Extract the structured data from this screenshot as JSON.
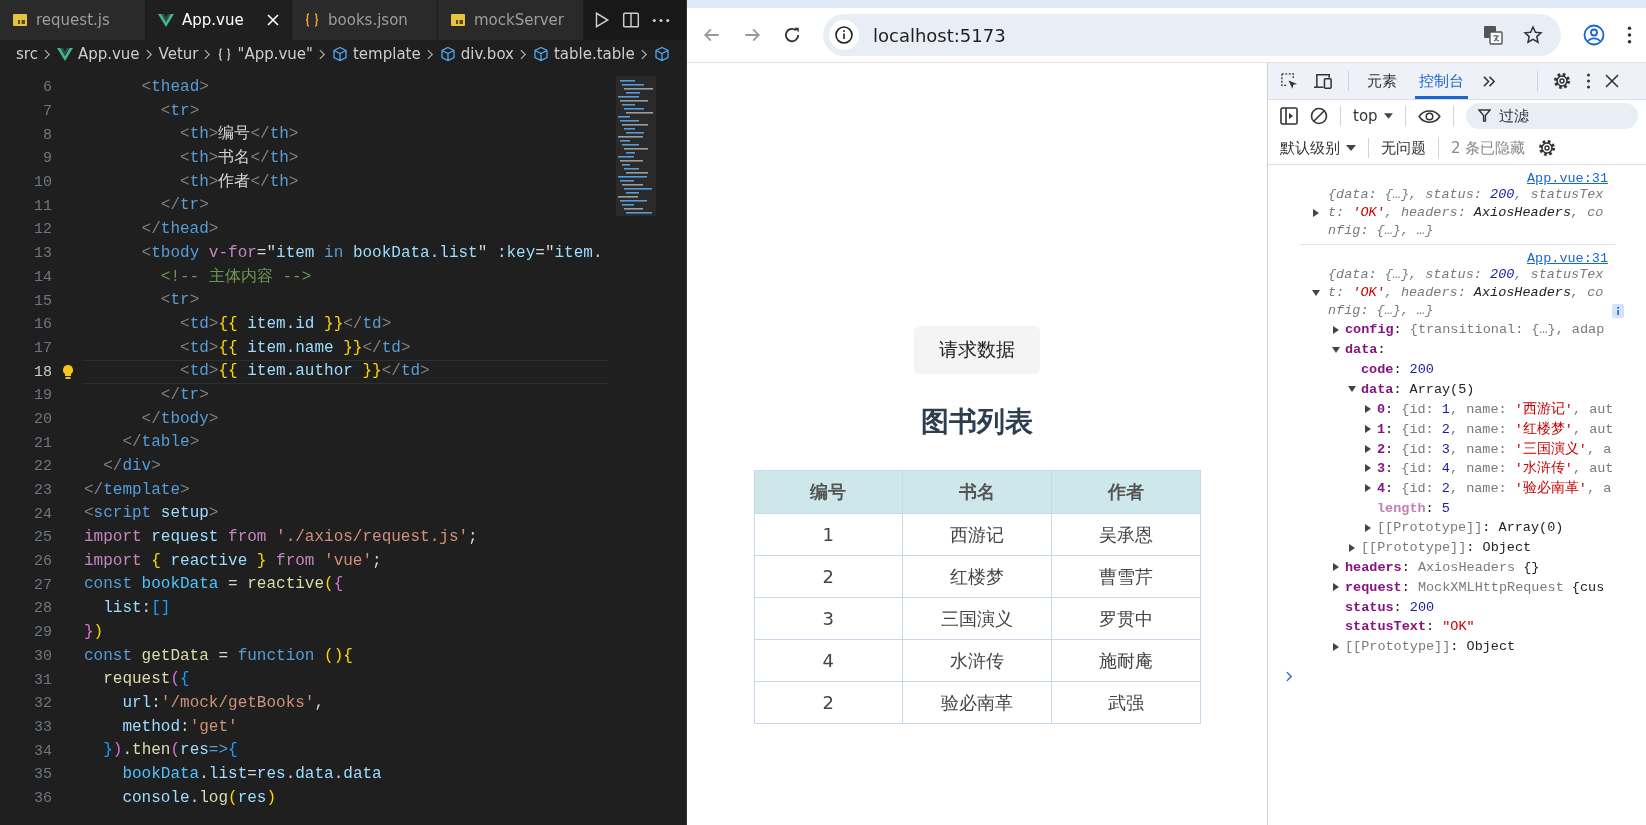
{
  "editor": {
    "tabs": [
      {
        "label": "request.js",
        "kind": "js",
        "selected": false
      },
      {
        "label": "App.vue",
        "kind": "vue",
        "selected": true
      },
      {
        "label": "books.json",
        "kind": "json",
        "selected": false
      },
      {
        "label": "mockServer",
        "kind": "js",
        "selected": false
      }
    ],
    "breadcrumb": [
      {
        "label": "src",
        "kind": "plain"
      },
      {
        "label": "App.vue",
        "kind": "vue"
      },
      {
        "label": "Vetur",
        "kind": "plain"
      },
      {
        "label": "\"App.vue\"",
        "kind": "braces"
      },
      {
        "label": "template",
        "kind": "cube"
      },
      {
        "label": "div.box",
        "kind": "cube"
      },
      {
        "label": "table.table",
        "kind": "cube"
      },
      {
        "kind": "cube"
      }
    ],
    "lines": [
      {
        "number": "6",
        "active": false,
        "tokens": [
          {
            "kind": "p",
            "t": "      <"
          },
          {
            "kind": "t",
            "t": "thead"
          },
          {
            "kind": "p",
            "t": ">"
          }
        ]
      },
      {
        "number": "7",
        "active": false,
        "tokens": [
          {
            "kind": "p",
            "t": "        <"
          },
          {
            "kind": "t",
            "t": "tr"
          },
          {
            "kind": "p",
            "t": ">"
          }
        ]
      },
      {
        "number": "8",
        "active": false,
        "tokens": [
          {
            "kind": "p",
            "t": "          <"
          },
          {
            "kind": "t",
            "t": "th"
          },
          {
            "kind": "p",
            "t": ">"
          },
          {
            "kind": "x",
            "t": "编号"
          },
          {
            "kind": "p",
            "t": "</"
          },
          {
            "kind": "t",
            "t": "th"
          },
          {
            "kind": "p",
            "t": ">"
          }
        ]
      },
      {
        "number": "9",
        "active": false,
        "tokens": [
          {
            "kind": "p",
            "t": "          <"
          },
          {
            "kind": "t",
            "t": "th"
          },
          {
            "kind": "p",
            "t": ">"
          },
          {
            "kind": "x",
            "t": "书名"
          },
          {
            "kind": "p",
            "t": "</"
          },
          {
            "kind": "t",
            "t": "th"
          },
          {
            "kind": "p",
            "t": ">"
          }
        ]
      },
      {
        "number": "10",
        "active": false,
        "tokens": [
          {
            "kind": "p",
            "t": "          <"
          },
          {
            "kind": "t",
            "t": "th"
          },
          {
            "kind": "p",
            "t": ">"
          },
          {
            "kind": "x",
            "t": "作者"
          },
          {
            "kind": "p",
            "t": "</"
          },
          {
            "kind": "t",
            "t": "th"
          },
          {
            "kind": "p",
            "t": ">"
          }
        ]
      },
      {
        "number": "11",
        "active": false,
        "tokens": [
          {
            "kind": "p",
            "t": "        </"
          },
          {
            "kind": "t",
            "t": "tr"
          },
          {
            "kind": "p",
            "t": ">"
          }
        ]
      },
      {
        "number": "12",
        "active": false,
        "tokens": [
          {
            "kind": "p",
            "t": "      </"
          },
          {
            "kind": "t",
            "t": "thead"
          },
          {
            "kind": "p",
            "t": ">"
          }
        ]
      },
      {
        "number": "13",
        "active": false,
        "tokens": [
          {
            "kind": "p",
            "t": "      <"
          },
          {
            "kind": "t",
            "t": "tbody "
          },
          {
            "kind": "a",
            "t": "v-for"
          },
          {
            "kind": "x",
            "t": "=\""
          },
          {
            "kind": "v",
            "t": "item "
          },
          {
            "kind": "st",
            "t": "in "
          },
          {
            "kind": "v",
            "t": "bookData.list"
          },
          {
            "kind": "x",
            "t": "\" "
          },
          {
            "kind": "v",
            "t": ":key"
          },
          {
            "kind": "x",
            "t": "=\""
          },
          {
            "kind": "v",
            "t": "item."
          }
        ]
      },
      {
        "number": "14",
        "active": false,
        "tokens": [
          {
            "kind": "cm",
            "t": "        <!-- 主体内容 -->"
          }
        ]
      },
      {
        "number": "15",
        "active": false,
        "tokens": [
          {
            "kind": "p",
            "t": "        <"
          },
          {
            "kind": "t",
            "t": "tr"
          },
          {
            "kind": "p",
            "t": ">"
          }
        ]
      },
      {
        "number": "16",
        "active": false,
        "tokens": [
          {
            "kind": "p",
            "t": "          <"
          },
          {
            "kind": "t",
            "t": "td"
          },
          {
            "kind": "p",
            "t": ">"
          },
          {
            "kind": "b1",
            "t": "{{"
          },
          {
            "kind": "v",
            "t": " item.id "
          },
          {
            "kind": "b1",
            "t": "}}"
          },
          {
            "kind": "p",
            "t": "</"
          },
          {
            "kind": "t",
            "t": "td"
          },
          {
            "kind": "p",
            "t": ">"
          }
        ]
      },
      {
        "number": "17",
        "active": false,
        "tokens": [
          {
            "kind": "p",
            "t": "          <"
          },
          {
            "kind": "t",
            "t": "td"
          },
          {
            "kind": "p",
            "t": ">"
          },
          {
            "kind": "b1",
            "t": "{{"
          },
          {
            "kind": "v",
            "t": " item.name "
          },
          {
            "kind": "b1",
            "t": "}}"
          },
          {
            "kind": "p",
            "t": "</"
          },
          {
            "kind": "t",
            "t": "td"
          },
          {
            "kind": "p",
            "t": ">"
          }
        ]
      },
      {
        "number": "18",
        "active": true,
        "tokens": [
          {
            "kind": "p",
            "t": "          <"
          },
          {
            "kind": "t",
            "t": "td"
          },
          {
            "kind": "p",
            "t": ">"
          },
          {
            "kind": "b1",
            "t": "{{"
          },
          {
            "kind": "v",
            "t": " item.author "
          },
          {
            "kind": "b1",
            "t": "}}"
          },
          {
            "kind": "p",
            "t": "</"
          },
          {
            "kind": "t",
            "t": "td"
          },
          {
            "kind": "p",
            "t": ">"
          }
        ]
      },
      {
        "number": "19",
        "active": false,
        "tokens": [
          {
            "kind": "p",
            "t": "        </"
          },
          {
            "kind": "t",
            "t": "tr"
          },
          {
            "kind": "p",
            "t": ">"
          }
        ]
      },
      {
        "number": "20",
        "active": false,
        "tokens": [
          {
            "kind": "p",
            "t": "      </"
          },
          {
            "kind": "t",
            "t": "tbody"
          },
          {
            "kind": "p",
            "t": ">"
          }
        ]
      },
      {
        "number": "21",
        "active": false,
        "tokens": [
          {
            "kind": "p",
            "t": "    </"
          },
          {
            "kind": "t",
            "t": "table"
          },
          {
            "kind": "p",
            "t": ">"
          }
        ]
      },
      {
        "number": "22",
        "active": false,
        "tokens": [
          {
            "kind": "p",
            "t": "  </"
          },
          {
            "kind": "t",
            "t": "div"
          },
          {
            "kind": "p",
            "t": ">"
          }
        ]
      },
      {
        "number": "23",
        "active": false,
        "tokens": [
          {
            "kind": "p",
            "t": "</"
          },
          {
            "kind": "t",
            "t": "template"
          },
          {
            "kind": "p",
            "t": ">"
          }
        ]
      },
      {
        "number": "24",
        "active": false,
        "tokens": [
          {
            "kind": "p",
            "t": "<"
          },
          {
            "kind": "t",
            "t": "script"
          },
          {
            "kind": "v",
            "t": " setup"
          },
          {
            "kind": "p",
            "t": ">"
          }
        ]
      },
      {
        "number": "25",
        "active": false,
        "tokens": [
          {
            "kind": "kw",
            "t": "import"
          },
          {
            "kind": "v",
            "t": " request "
          },
          {
            "kind": "kw",
            "t": "from "
          },
          {
            "kind": "s",
            "t": "'./axios/request.js'"
          },
          {
            "kind": "x",
            "t": ";"
          }
        ]
      },
      {
        "number": "26",
        "active": false,
        "tokens": [
          {
            "kind": "kw",
            "t": "import "
          },
          {
            "kind": "b1",
            "t": "{"
          },
          {
            "kind": "v",
            "t": " reactive "
          },
          {
            "kind": "b1",
            "t": "}"
          },
          {
            "kind": "kw",
            "t": " from "
          },
          {
            "kind": "s",
            "t": "'vue'"
          },
          {
            "kind": "x",
            "t": ";"
          }
        ]
      },
      {
        "number": "27",
        "active": false,
        "tokens": [
          {
            "kind": "st",
            "t": "const "
          },
          {
            "kind": "c",
            "t": "bookData"
          },
          {
            "kind": "x",
            "t": " = "
          },
          {
            "kind": "f",
            "t": "reactive"
          },
          {
            "kind": "b1",
            "t": "("
          },
          {
            "kind": "b2",
            "t": "{"
          }
        ]
      },
      {
        "number": "28",
        "active": false,
        "tokens": [
          {
            "kind": "v",
            "t": "  list"
          },
          {
            "kind": "x",
            "t": ":"
          },
          {
            "kind": "b3",
            "t": "[]"
          }
        ]
      },
      {
        "number": "29",
        "active": false,
        "tokens": [
          {
            "kind": "b2",
            "t": "}"
          },
          {
            "kind": "b1",
            "t": ")"
          }
        ]
      },
      {
        "number": "30",
        "active": false,
        "tokens": [
          {
            "kind": "st",
            "t": "const "
          },
          {
            "kind": "f",
            "t": "getData"
          },
          {
            "kind": "x",
            "t": " = "
          },
          {
            "kind": "st",
            "t": "function "
          },
          {
            "kind": "b1",
            "t": "(){"
          }
        ]
      },
      {
        "number": "31",
        "active": false,
        "tokens": [
          {
            "kind": "f",
            "t": "  request"
          },
          {
            "kind": "b2",
            "t": "("
          },
          {
            "kind": "b3",
            "t": "{"
          }
        ]
      },
      {
        "number": "32",
        "active": false,
        "tokens": [
          {
            "kind": "v",
            "t": "    url"
          },
          {
            "kind": "x",
            "t": ":"
          },
          {
            "kind": "s",
            "t": "'/mock/getBooks'"
          },
          {
            "kind": "x",
            "t": ","
          }
        ]
      },
      {
        "number": "33",
        "active": false,
        "tokens": [
          {
            "kind": "v",
            "t": "    method"
          },
          {
            "kind": "x",
            "t": ":"
          },
          {
            "kind": "s",
            "t": "'get'"
          }
        ]
      },
      {
        "number": "34",
        "active": false,
        "tokens": [
          {
            "kind": "b3",
            "t": "  }"
          },
          {
            "kind": "b2",
            "t": ")"
          },
          {
            "kind": "x",
            "t": "."
          },
          {
            "kind": "f",
            "t": "then"
          },
          {
            "kind": "b2",
            "t": "("
          },
          {
            "kind": "v",
            "t": "res"
          },
          {
            "kind": "st",
            "t": "=>"
          },
          {
            "kind": "b3",
            "t": "{"
          }
        ]
      },
      {
        "number": "35",
        "active": false,
        "tokens": [
          {
            "kind": "c",
            "t": "    bookData"
          },
          {
            "kind": "x",
            "t": "."
          },
          {
            "kind": "v",
            "t": "list"
          },
          {
            "kind": "x",
            "t": "="
          },
          {
            "kind": "v",
            "t": "res"
          },
          {
            "kind": "x",
            "t": "."
          },
          {
            "kind": "v",
            "t": "data"
          },
          {
            "kind": "x",
            "t": "."
          },
          {
            "kind": "v",
            "t": "data"
          }
        ]
      },
      {
        "number": "36",
        "active": false,
        "tokens": [
          {
            "kind": "v",
            "t": "    console"
          },
          {
            "kind": "x",
            "t": "."
          },
          {
            "kind": "f",
            "t": "log"
          },
          {
            "kind": "b1",
            "t": "("
          },
          {
            "kind": "v",
            "t": "res"
          },
          {
            "kind": "b1",
            "t": ")"
          }
        ]
      }
    ]
  },
  "browser": {
    "url": "localhost:5173"
  },
  "page": {
    "button": "请求数据",
    "heading": "图书列表",
    "table": {
      "columns": [
        "编号",
        "书名",
        "作者"
      ],
      "rows": [
        [
          "1",
          "西游记",
          "吴承恩"
        ],
        [
          "2",
          "红楼梦",
          "曹雪芹"
        ],
        [
          "3",
          "三国演义",
          "罗贯中"
        ],
        [
          "4",
          "水浒传",
          "施耐庵"
        ],
        [
          "2",
          "验必南革",
          "武强"
        ]
      ]
    }
  },
  "devtools": {
    "tabs": [
      {
        "label": "元素",
        "selected": false
      },
      {
        "label": "控制台",
        "selected": true
      }
    ],
    "context": "top",
    "filter_placeholder": "过滤",
    "level": "默认级别",
    "issues": "无问题",
    "hidden": "2 条已隐藏",
    "console": [
      {
        "source": "App.vue:31",
        "expanded": false,
        "summary": [
          {
            "kind": "g",
            "t": "{data: {…}, status: "
          },
          {
            "kind": "n",
            "t": "200"
          },
          {
            "kind": "g",
            "t": ", statusText: "
          },
          {
            "kind": "r",
            "t": "'OK'"
          },
          {
            "kind": "g",
            "t": ", headers: "
          },
          {
            "kind": "o",
            "t": "AxiosHeaders"
          },
          {
            "kind": "g",
            "t": ", config: {…},  …}"
          }
        ]
      },
      {
        "source": "App.vue:31",
        "expanded": true,
        "summary": [
          {
            "kind": "g",
            "t": "{data: {…}, status: "
          },
          {
            "kind": "n",
            "t": "200"
          },
          {
            "kind": "g",
            "t": ", statusText: "
          },
          {
            "kind": "r",
            "t": "'OK'"
          },
          {
            "kind": "g",
            "t": ", headers: "
          },
          {
            "kind": "o",
            "t": "AxiosHeaders"
          },
          {
            "kind": "g",
            "t": ", config: {…},  …}"
          }
        ],
        "children": [
          {
            "kind": "branch",
            "expanded": false,
            "text": [
              {
                "kind": "key",
                "t": "config"
              },
              {
                "kind": "o",
                "t": ": "
              },
              {
                "kind": "g",
                "t": "{transitional: {…}, adap"
              }
            ]
          },
          {
            "kind": "branch",
            "expanded": true,
            "text": [
              {
                "kind": "key",
                "t": "data"
              },
              {
                "kind": "o",
                "t": ":"
              }
            ],
            "children": [
              {
                "kind": "leaf",
                "text": [
                  {
                    "kind": "key",
                    "t": "code"
                  },
                  {
                    "kind": "o",
                    "t": ": "
                  },
                  {
                    "kind": "n",
                    "t": "200"
                  }
                ]
              },
              {
                "kind": "branch",
                "expanded": true,
                "text": [
                  {
                    "kind": "key",
                    "t": "data"
                  },
                  {
                    "kind": "o",
                    "t": ": Array(5)"
                  }
                ],
                "children": [
                  {
                    "kind": "branch",
                    "expanded": false,
                    "text": [
                      {
                        "kind": "key",
                        "t": "0"
                      },
                      {
                        "kind": "o",
                        "t": ": "
                      },
                      {
                        "kind": "g",
                        "t": "{id: "
                      },
                      {
                        "kind": "n",
                        "t": "1"
                      },
                      {
                        "kind": "g",
                        "t": ", name: "
                      },
                      {
                        "kind": "r",
                        "t": "'西游记'"
                      },
                      {
                        "kind": "g",
                        "t": ", aut"
                      }
                    ]
                  },
                  {
                    "kind": "branch",
                    "expanded": false,
                    "text": [
                      {
                        "kind": "key",
                        "t": "1"
                      },
                      {
                        "kind": "o",
                        "t": ": "
                      },
                      {
                        "kind": "g",
                        "t": "{id: "
                      },
                      {
                        "kind": "n",
                        "t": "2"
                      },
                      {
                        "kind": "g",
                        "t": ", name: "
                      },
                      {
                        "kind": "r",
                        "t": "'红楼梦'"
                      },
                      {
                        "kind": "g",
                        "t": ", aut"
                      }
                    ]
                  },
                  {
                    "kind": "branch",
                    "expanded": false,
                    "text": [
                      {
                        "kind": "key",
                        "t": "2"
                      },
                      {
                        "kind": "o",
                        "t": ": "
                      },
                      {
                        "kind": "g",
                        "t": "{id: "
                      },
                      {
                        "kind": "n",
                        "t": "3"
                      },
                      {
                        "kind": "g",
                        "t": ", name: "
                      },
                      {
                        "kind": "r",
                        "t": "'三国演义'"
                      },
                      {
                        "kind": "g",
                        "t": ", a"
                      }
                    ]
                  },
                  {
                    "kind": "branch",
                    "expanded": false,
                    "text": [
                      {
                        "kind": "key",
                        "t": "3"
                      },
                      {
                        "kind": "o",
                        "t": ": "
                      },
                      {
                        "kind": "g",
                        "t": "{id: "
                      },
                      {
                        "kind": "n",
                        "t": "4"
                      },
                      {
                        "kind": "g",
                        "t": ", name: "
                      },
                      {
                        "kind": "r",
                        "t": "'水浒传'"
                      },
                      {
                        "kind": "g",
                        "t": ", aut"
                      }
                    ]
                  },
                  {
                    "kind": "branch",
                    "expanded": false,
                    "text": [
                      {
                        "kind": "key",
                        "t": "4"
                      },
                      {
                        "kind": "o",
                        "t": ": "
                      },
                      {
                        "kind": "g",
                        "t": "{id: "
                      },
                      {
                        "kind": "n",
                        "t": "2"
                      },
                      {
                        "kind": "g",
                        "t": ", name: "
                      },
                      {
                        "kind": "r",
                        "t": "'验必南革'"
                      },
                      {
                        "kind": "g",
                        "t": ", a"
                      }
                    ]
                  },
                  {
                    "kind": "leaf",
                    "text": [
                      {
                        "kind": "dim",
                        "t": "length"
                      },
                      {
                        "kind": "o",
                        "t": ": "
                      },
                      {
                        "kind": "n",
                        "t": "5"
                      }
                    ]
                  },
                  {
                    "kind": "branch",
                    "expanded": false,
                    "text": [
                      {
                        "kind": "g",
                        "t": "[[Prototype]]"
                      },
                      {
                        "kind": "o",
                        "t": ": Array(0)"
                      }
                    ]
                  }
                ]
              },
              {
                "kind": "branch",
                "expanded": false,
                "text": [
                  {
                    "kind": "g",
                    "t": "[[Prototype]]"
                  },
                  {
                    "kind": "o",
                    "t": ": Object"
                  }
                ]
              }
            ]
          },
          {
            "kind": "branch",
            "expanded": false,
            "text": [
              {
                "kind": "key",
                "t": "headers"
              },
              {
                "kind": "o",
                "t": ": "
              },
              {
                "kind": "g",
                "t": "AxiosHeaders  "
              },
              {
                "kind": "o",
                "t": "{}"
              }
            ]
          },
          {
            "kind": "branch",
            "expanded": false,
            "text": [
              {
                "kind": "key",
                "t": "request"
              },
              {
                "kind": "o",
                "t": ": "
              },
              {
                "kind": "g",
                "t": "MockXMLHttpRequest  "
              },
              {
                "kind": "o",
                "t": "{cus"
              }
            ]
          },
          {
            "kind": "leaf",
            "text": [
              {
                "kind": "key",
                "t": "status"
              },
              {
                "kind": "o",
                "t": ": "
              },
              {
                "kind": "n",
                "t": "200"
              }
            ]
          },
          {
            "kind": "leaf",
            "text": [
              {
                "kind": "key",
                "t": "statusText"
              },
              {
                "kind": "o",
                "t": ": "
              },
              {
                "kind": "r",
                "t": "\"OK\""
              }
            ]
          },
          {
            "kind": "branch",
            "expanded": false,
            "text": [
              {
                "kind": "g",
                "t": "[[Prototype]]"
              },
              {
                "kind": "o",
                "t": ": Object"
              }
            ]
          }
        ]
      }
    ]
  }
}
